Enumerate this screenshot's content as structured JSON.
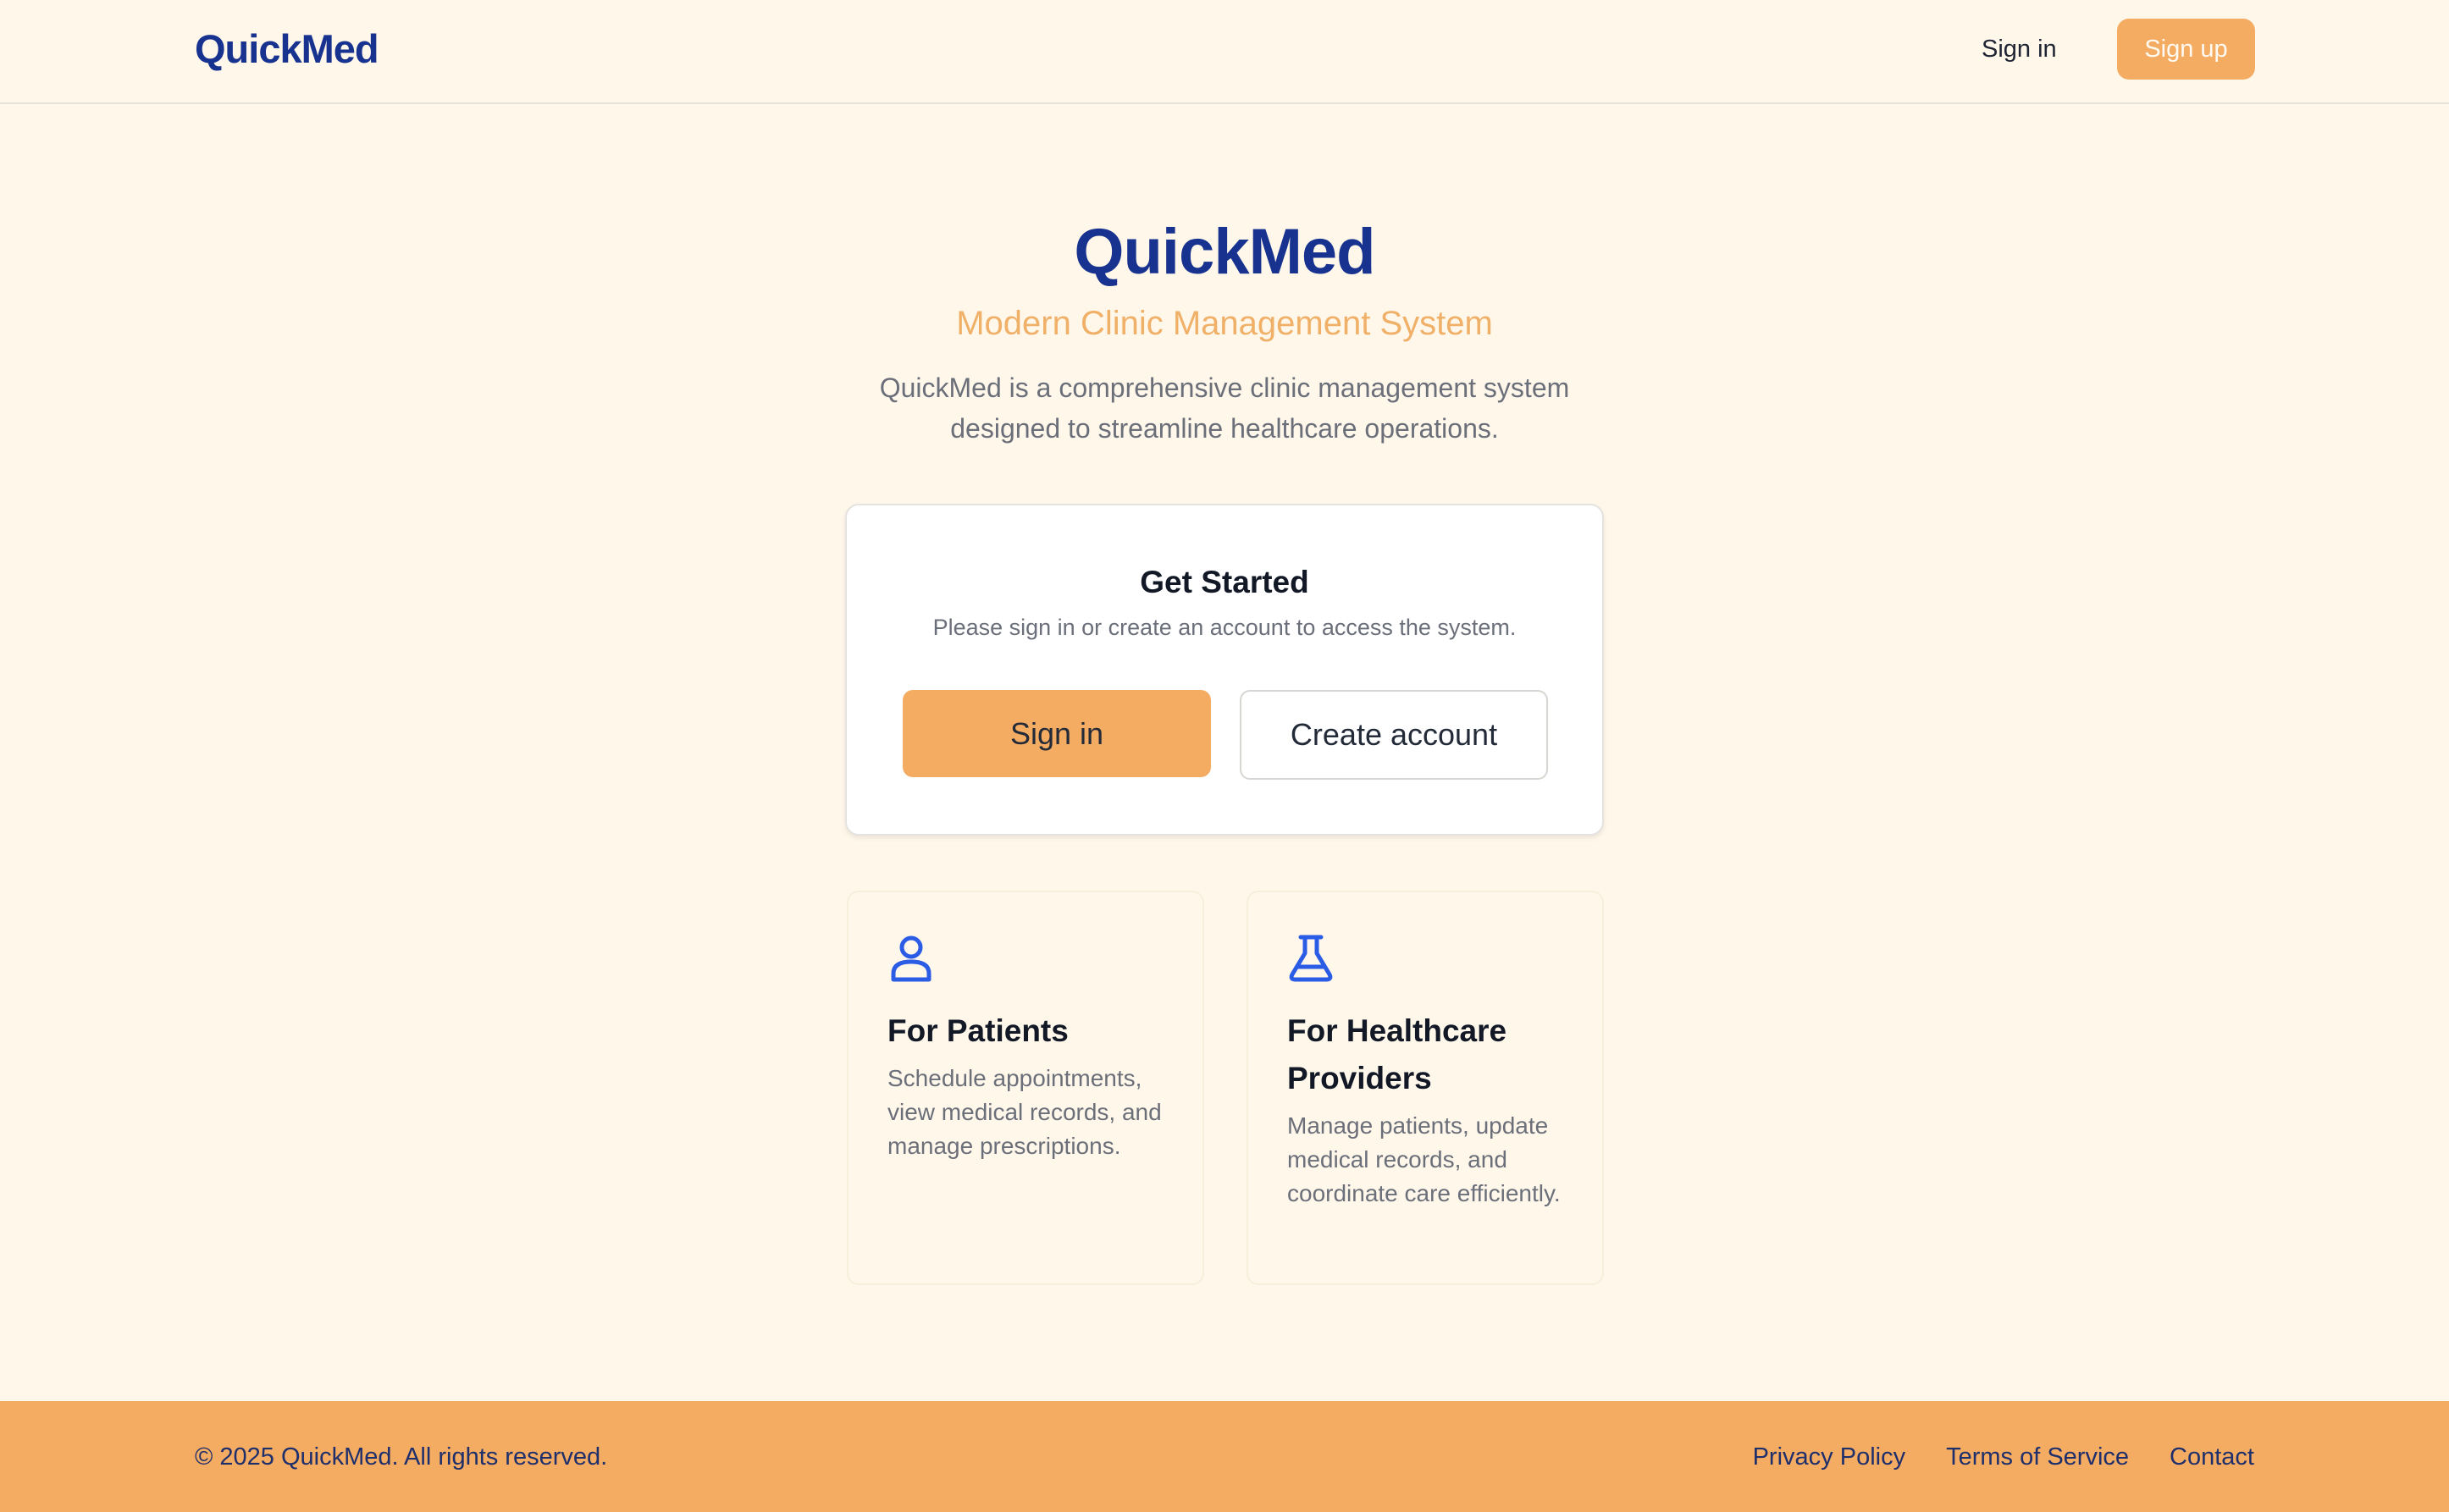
{
  "header": {
    "logo": "QuickMed",
    "signin_label": "Sign in",
    "signup_label": "Sign up"
  },
  "hero": {
    "title": "QuickMed",
    "subtitle": "Modern Clinic Management System",
    "description": "QuickMed is a comprehensive clinic management system designed to streamline healthcare operations."
  },
  "get_started": {
    "title": "Get Started",
    "text": "Please sign in or create an account to access the system.",
    "signin_label": "Sign in",
    "create_label": "Create account"
  },
  "features": [
    {
      "icon": "user-icon",
      "title": "For Patients",
      "text": "Schedule appointments, view medical records, and manage prescriptions."
    },
    {
      "icon": "flask-icon",
      "title": "For Healthcare Providers",
      "text": "Manage patients, update medical records, and coordinate care efficiently."
    }
  ],
  "footer": {
    "copyright": "© 2025 QuickMed. All rights reserved.",
    "links": [
      "Privacy Policy",
      "Terms of Service",
      "Contact"
    ]
  },
  "colors": {
    "background": "#fff7ea",
    "brand_blue": "#17328f",
    "accent_orange": "#f4ac63",
    "icon_blue": "#2b5ce6"
  }
}
